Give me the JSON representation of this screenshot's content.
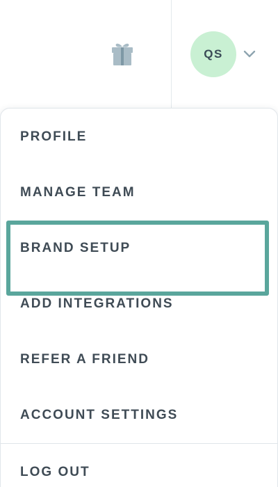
{
  "header": {
    "gift_icon": "gift-icon",
    "avatar_initials": "QS",
    "avatar_color": "#c9f0d3",
    "chevron_icon": "chevron-down-icon"
  },
  "menu": {
    "items": [
      {
        "label": "PROFILE"
      },
      {
        "label": "MANAGE TEAM"
      },
      {
        "label": "BRAND SETUP",
        "highlighted": true
      },
      {
        "label": "ADD INTEGRATIONS"
      },
      {
        "label": "REFER A FRIEND"
      },
      {
        "label": "ACCOUNT SETTINGS"
      },
      {
        "label": "LOG OUT"
      }
    ],
    "highlight_color": "#5aa69c",
    "text_color": "#3f4b55"
  }
}
